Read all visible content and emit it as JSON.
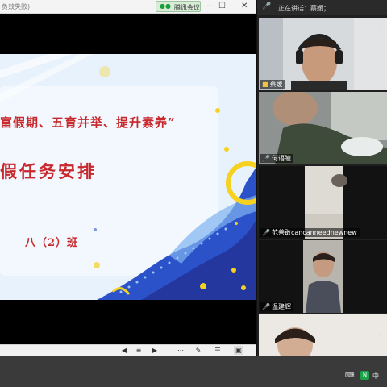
{
  "window": {
    "title": "负效失败)",
    "meeting_label": "腾讯会议",
    "minimize_glyph": "—",
    "maximize_glyph": "☐",
    "close_glyph": "✕"
  },
  "slide": {
    "line1": "富假期、五育并举、提升素养”",
    "line2": "假任务安排",
    "line3": "八（2）班",
    "colors": {
      "title_red": "#c8282c",
      "background": "#e6f1fb",
      "accent_blue": "#2c52c9",
      "accent_yellow": "#f5d21f"
    }
  },
  "controls": {
    "prev": "◀",
    "grid": "≡",
    "next": "▶",
    "thumbs": "⋯",
    "pen": "✎",
    "note": "☰",
    "menu": "⚙",
    "present": "▣"
  },
  "panel": {
    "speaking_label": "正在讲话：蔡媛；",
    "participants": [
      {
        "name": "蔡媛"
      },
      {
        "name": "何语瞳"
      },
      {
        "name": "范善敢cancanneednewnew"
      },
      {
        "name": "温建辉"
      },
      {
        "name": ""
      }
    ],
    "collapse_glyph": "⌄"
  },
  "taskbar": {
    "tray_ime": "中",
    "tray_badge": "N",
    "tray_icons": "⌨  ↑  ◉"
  }
}
